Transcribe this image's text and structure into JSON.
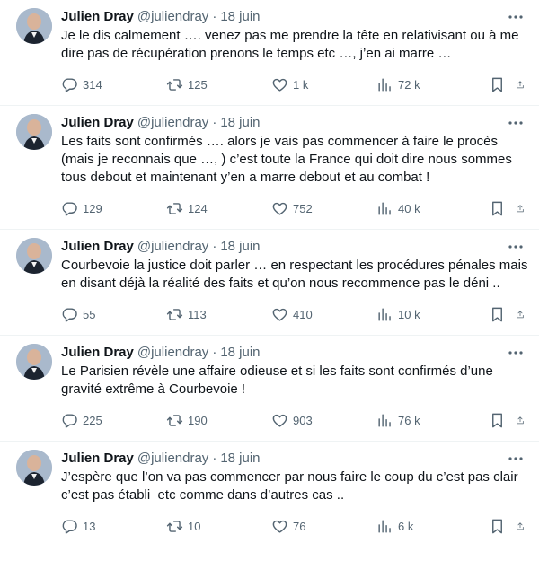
{
  "tweets": [
    {
      "author": "Julien Dray",
      "handle": "@juliendray",
      "separator": "·",
      "time": "18 juin",
      "text": "Je le dis calmement …. venez pas me prendre la tête en relativisant ou à me dire pas de récupération prenons le temps etc …, j’en ai marre …",
      "replies": "314",
      "retweets": "125",
      "likes": "1 k",
      "views": "72 k"
    },
    {
      "author": "Julien Dray",
      "handle": "@juliendray",
      "separator": "·",
      "time": "18 juin",
      "text": "Les faits sont confirmés …. alors je vais pas commencer à faire le procès (mais je reconnais que …, ) c’est toute la France qui doit dire nous sommes tous debout et maintenant y’en a marre debout et au combat !",
      "replies": "129",
      "retweets": "124",
      "likes": "752",
      "views": "40 k"
    },
    {
      "author": "Julien Dray",
      "handle": "@juliendray",
      "separator": "·",
      "time": "18 juin",
      "text": "Courbevoie la justice doit parler … en respectant les procédures pénales mais en disant déjà la réalité des faits et qu’on nous recommence pas le déni ..",
      "replies": "55",
      "retweets": "113",
      "likes": "410",
      "views": "10 k"
    },
    {
      "author": "Julien Dray",
      "handle": "@juliendray",
      "separator": "·",
      "time": "18 juin",
      "text": "Le Parisien révèle une affaire odieuse et si les faits sont confirmés d’une gravité extrême à Courbevoie !",
      "replies": "225",
      "retweets": "190",
      "likes": "903",
      "views": "76 k"
    },
    {
      "author": "Julien Dray",
      "handle": "@juliendray",
      "separator": "·",
      "time": "18 juin",
      "text": "J’espère que l’on va pas commencer par nous faire le coup du c’est pas clair c’est pas établi  etc comme dans d’autres cas ..",
      "replies": "13",
      "retweets": "10",
      "likes": "76",
      "views": "6 k"
    }
  ],
  "icons": {
    "more": "more-dots-icon",
    "reply": "reply-bubble-icon",
    "retweet": "retweet-icon",
    "like": "heart-icon",
    "views": "views-chart-icon",
    "bookmark": "bookmark-icon",
    "share": "share-icon"
  },
  "colors": {
    "text": "#0f1419",
    "secondary": "#536471",
    "divider": "#eff3f4"
  }
}
